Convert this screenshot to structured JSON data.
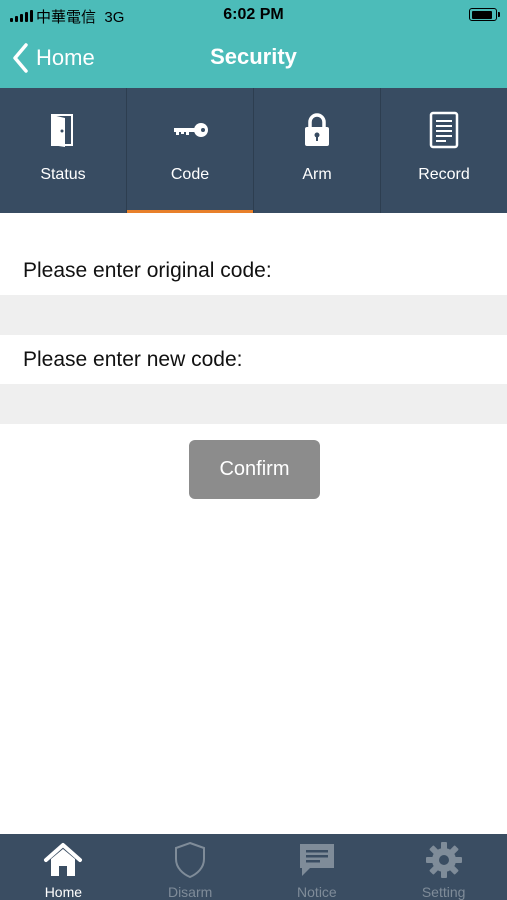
{
  "status_bar": {
    "carrier": "中華電信",
    "network": "3G",
    "time": "6:02 PM"
  },
  "header": {
    "back_label": "Home",
    "title": "Security",
    "background_color": "#4cbcb9"
  },
  "tabs": [
    {
      "label": "Status",
      "icon": "door-icon",
      "active": false
    },
    {
      "label": "Code",
      "icon": "key-icon",
      "active": true
    },
    {
      "label": "Arm",
      "icon": "lock-icon",
      "active": false
    },
    {
      "label": "Record",
      "icon": "document-icon",
      "active": false
    }
  ],
  "form": {
    "original_code_label": "Please enter original code:",
    "original_code_value": "",
    "new_code_label": "Please enter new code:",
    "new_code_value": "",
    "confirm_label": "Confirm"
  },
  "bottom_nav": [
    {
      "label": "Home",
      "icon": "home-icon",
      "active": true
    },
    {
      "label": "Disarm",
      "icon": "shield-icon",
      "active": false
    },
    {
      "label": "Notice",
      "icon": "chat-icon",
      "active": false
    },
    {
      "label": "Setting",
      "icon": "gear-icon",
      "active": false
    }
  ],
  "colors": {
    "tab_bar": "#384c62",
    "active_tab_underline": "#e8802a",
    "confirm_button": "#8c8c8c",
    "bottom_nav": "#3a4d62"
  }
}
